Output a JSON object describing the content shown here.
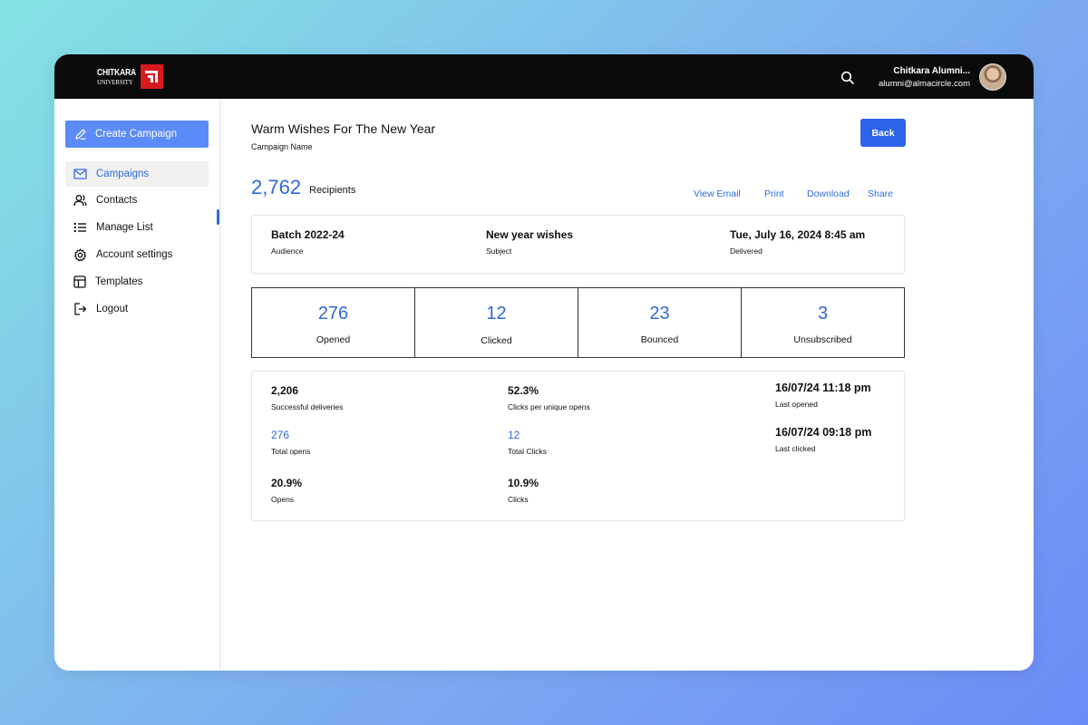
{
  "header": {
    "logo": {
      "line1": "CHITKARA",
      "line2": "UNIVERSITY"
    },
    "user_name": "Chitkara Alumni...",
    "user_email": "alumni@almacircle.com"
  },
  "sidebar": {
    "create_label": "Create Campaign",
    "items": [
      {
        "label": "Campaigns",
        "icon": "mail-icon"
      },
      {
        "label": "Contacts",
        "icon": "users-icon"
      },
      {
        "label": "Manage List",
        "icon": "list-icon"
      },
      {
        "label": "Account settings",
        "icon": "gear-icon"
      },
      {
        "label": "Templates",
        "icon": "template-icon"
      },
      {
        "label": "Logout",
        "icon": "logout-icon"
      }
    ]
  },
  "campaign": {
    "title": "Warm Wishes For The New Year",
    "subtitle": "Campaign Name",
    "back_label": "Back",
    "recipients_count": "2,762",
    "recipients_label": "Recipients",
    "actions": [
      "View Email",
      "Print",
      "Download",
      "Share"
    ]
  },
  "info": {
    "audience_value": "Batch 2022-24",
    "audience_label": "Audience",
    "subject_value": "New year wishes",
    "subject_label": "Subject",
    "delivered_value": "Tue, July 16, 2024 8:45 am",
    "delivered_label": "Delivered"
  },
  "stats": [
    {
      "value": "276",
      "label": "Opened"
    },
    {
      "value": "12",
      "label": "Clicked"
    },
    {
      "value": "23",
      "label": "Bounced"
    },
    {
      "value": "3",
      "label": "Unsubscribed"
    }
  ],
  "details": {
    "successful_deliveries": {
      "value": "2,206",
      "label": "Successful deliveries"
    },
    "total_opens": {
      "value": "276",
      "label": "Total opens"
    },
    "opens_rate": {
      "value": "20.9%",
      "label": "Opens"
    },
    "clicks_per_unique": {
      "value": "52.3%",
      "label": "Clicks per unique opens"
    },
    "total_clicks": {
      "value": "12",
      "label": "Total Clicks"
    },
    "clicks_rate": {
      "value": "10.9%",
      "label": "Clicks"
    },
    "last_opened": {
      "value": "16/07/24 11:18 pm",
      "label": "Last opened"
    },
    "last_clicked": {
      "value": "16/07/24 09:18 pm",
      "label": "Last clicked"
    }
  },
  "colors": {
    "accent": "#2f6be0",
    "primary_button": "#2b63ea",
    "create_button": "#5a8bf8",
    "topbar": "#0b0b0b",
    "logo_red": "#d71a1f"
  }
}
